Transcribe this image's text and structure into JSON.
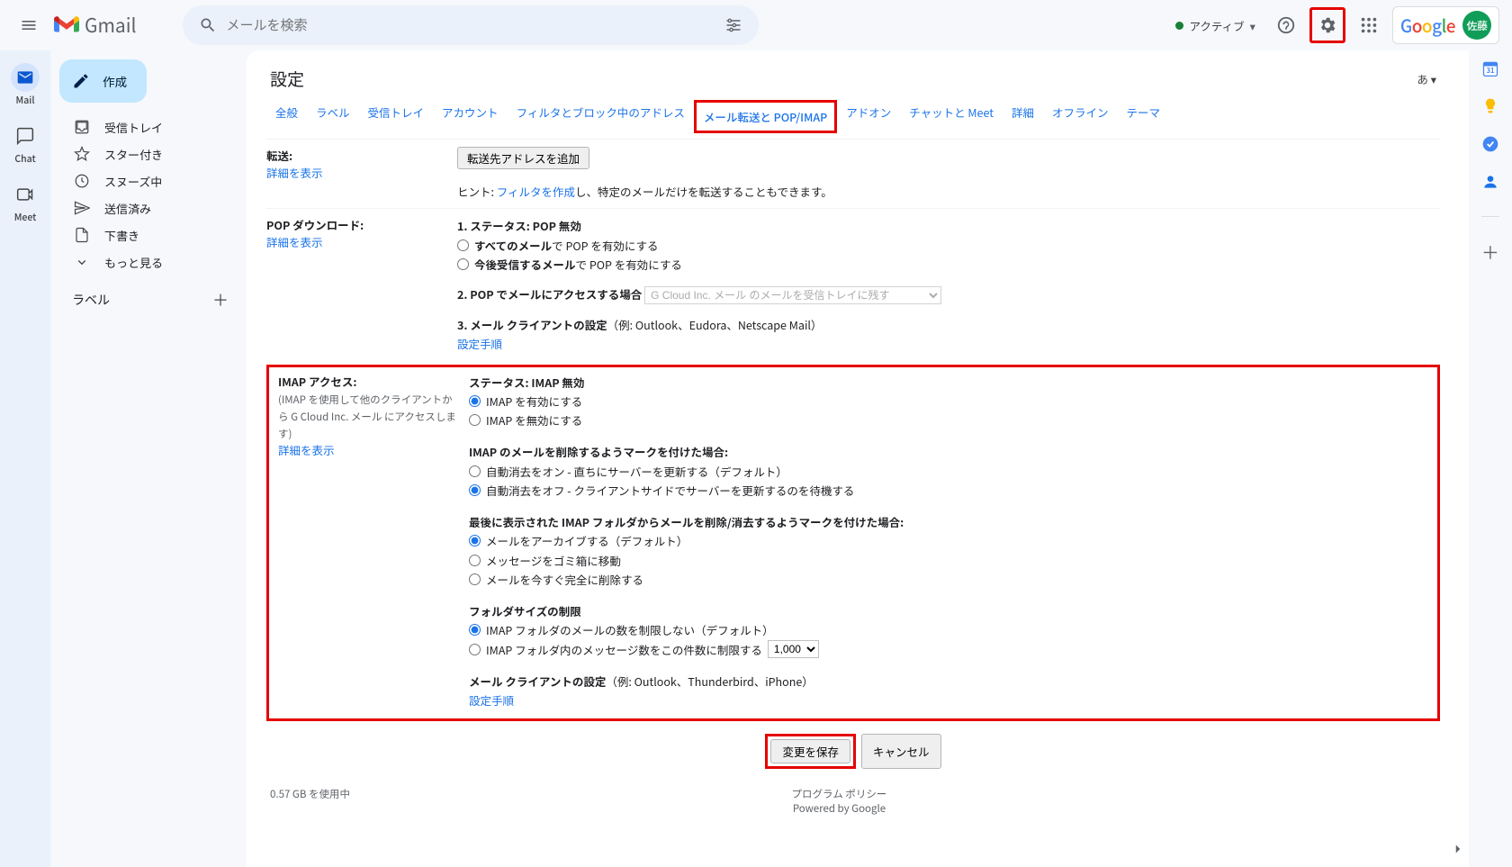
{
  "header": {
    "product": "Gmail",
    "search_placeholder": "メールを検索",
    "status": "アクティブ",
    "google": {
      "g1": "G",
      "o1": "o",
      "o2": "o",
      "g2": "g",
      "l": "l",
      "e": "e"
    },
    "avatar": "佐藤"
  },
  "rail": {
    "mail": "Mail",
    "chat": "Chat",
    "meet": "Meet"
  },
  "sidebar": {
    "compose": "作成",
    "items": [
      {
        "label": "受信トレイ"
      },
      {
        "label": "スター付き"
      },
      {
        "label": "スヌーズ中"
      },
      {
        "label": "送信済み"
      },
      {
        "label": "下書き"
      },
      {
        "label": "もっと見る"
      }
    ],
    "labels_head": "ラベル"
  },
  "settings": {
    "title": "設定",
    "lang": "あ ▾",
    "tabs": [
      "全般",
      "ラベル",
      "受信トレイ",
      "アカウント",
      "フィルタとブロック中のアドレス",
      "メール転送と POP/IMAP",
      "アドオン",
      "チャットと Meet",
      "詳細",
      "オフライン",
      "テーマ"
    ],
    "forwarding": {
      "heading": "転送:",
      "detail_link": "詳細を表示",
      "add_btn": "転送先アドレスを追加",
      "hint_prefix": "ヒント: ",
      "filter_link": "フィルタを作成",
      "hint_suffix": "し、特定のメールだけを転送することもできます。"
    },
    "pop": {
      "heading": "POP ダウンロード:",
      "detail_link": "詳細を表示",
      "s1": "1. ステータス: POP 無効",
      "opt_all_a": "すべてのメール",
      "opt_all_b": "で POP を有効にする",
      "opt_now_a": "今後受信するメール",
      "opt_now_b": "で POP を有効にする",
      "s2": "2. POP でメールにアクセスする場合",
      "drop": "G Cloud Inc. メール のメールを受信トレイに残す",
      "s3a": "3. メール クライアントの設定",
      "s3b": "（例: Outlook、Eudora、Netscape Mail）",
      "instr_link": "設定手順"
    },
    "imap": {
      "heading": "IMAP アクセス:",
      "note1": "(IMAP を使用して他のクライアントから G Cloud Inc. メール にアクセスします)",
      "detail_link": "詳細を表示",
      "status": "ステータス: IMAP 無効",
      "enable": "IMAP を有効にする",
      "disable": "IMAP を無効にする",
      "del_head": "IMAP のメールを削除するようマークを付けた場合:",
      "del_on": "自動消去をオン - 直ちにサーバーを更新する（デフォルト）",
      "del_off": "自動消去をオフ - クライアントサイドでサーバーを更新するのを待機する",
      "last_head": "最後に表示された IMAP フォルダからメールを削除/消去するようマークを付けた場合:",
      "archive": "メールをアーカイブする（デフォルト）",
      "trash": "メッセージをゴミ箱に移動",
      "delete": "メールを今すぐ完全に削除する",
      "folder_head": "フォルダサイズの制限",
      "nolimit": "IMAP フォルダのメールの数を制限しない（デフォルト）",
      "limit": "IMAP フォルダ内のメッセージ数をこの件数に制限する",
      "limit_val": "1,000",
      "client_a": "メール クライアントの設定",
      "client_b": "（例: Outlook、Thunderbird、iPhone）",
      "instr_link": "設定手順"
    },
    "actions": {
      "save": "変更を保存",
      "cancel": "キャンセル"
    },
    "footer": {
      "storage": "0.57 GB を使用中",
      "policy": "プログラム ポリシー",
      "powered": "Powered by Google"
    }
  }
}
